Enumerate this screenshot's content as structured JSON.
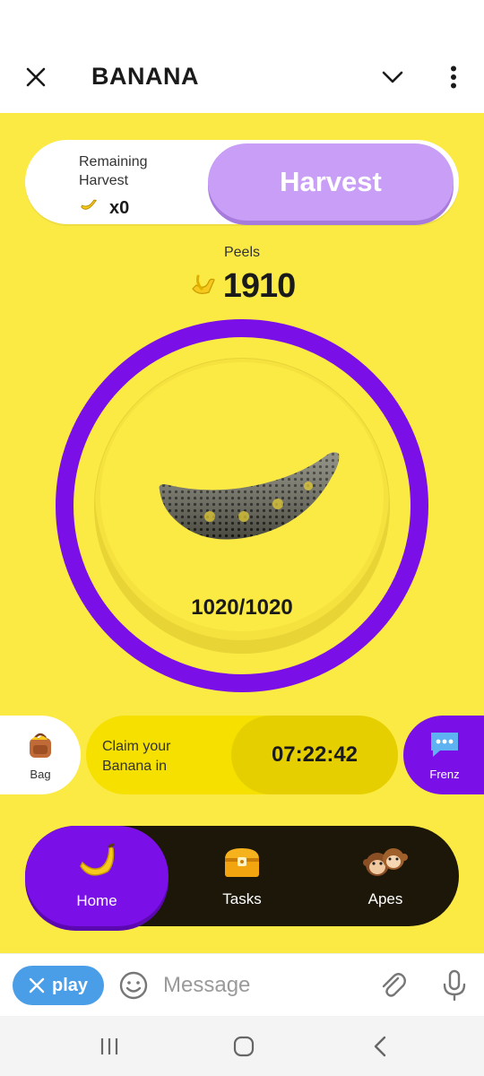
{
  "header": {
    "title": "BANANA",
    "icons": [
      "close-icon",
      "chevron-down-icon",
      "more-vert-icon"
    ]
  },
  "harvest": {
    "remaining_label": "Remaining Harvest",
    "remaining_count": "x0",
    "button_label": "Harvest"
  },
  "peels": {
    "label": "Peels",
    "value": "1910"
  },
  "banana": {
    "energy": "1020/1020"
  },
  "claim": {
    "bag_label": "Bag",
    "text": "Claim your Banana in",
    "timer": "07:22:42",
    "frenz_label": "Frenz"
  },
  "nav": {
    "items": [
      {
        "label": "Home",
        "icon": "banana-icon",
        "active": true
      },
      {
        "label": "Tasks",
        "icon": "treasure-chest-icon",
        "active": false
      },
      {
        "label": "Apes",
        "icon": "monkeys-icon",
        "active": false
      }
    ]
  },
  "message_bar": {
    "play_label": "play",
    "placeholder": "Message"
  },
  "colors": {
    "background": "#fbe944",
    "purple": "#7a0fe8",
    "harvest_button": "#c89ef7",
    "nav_dark": "#1c1708",
    "play_blue": "#4a9ee8"
  }
}
